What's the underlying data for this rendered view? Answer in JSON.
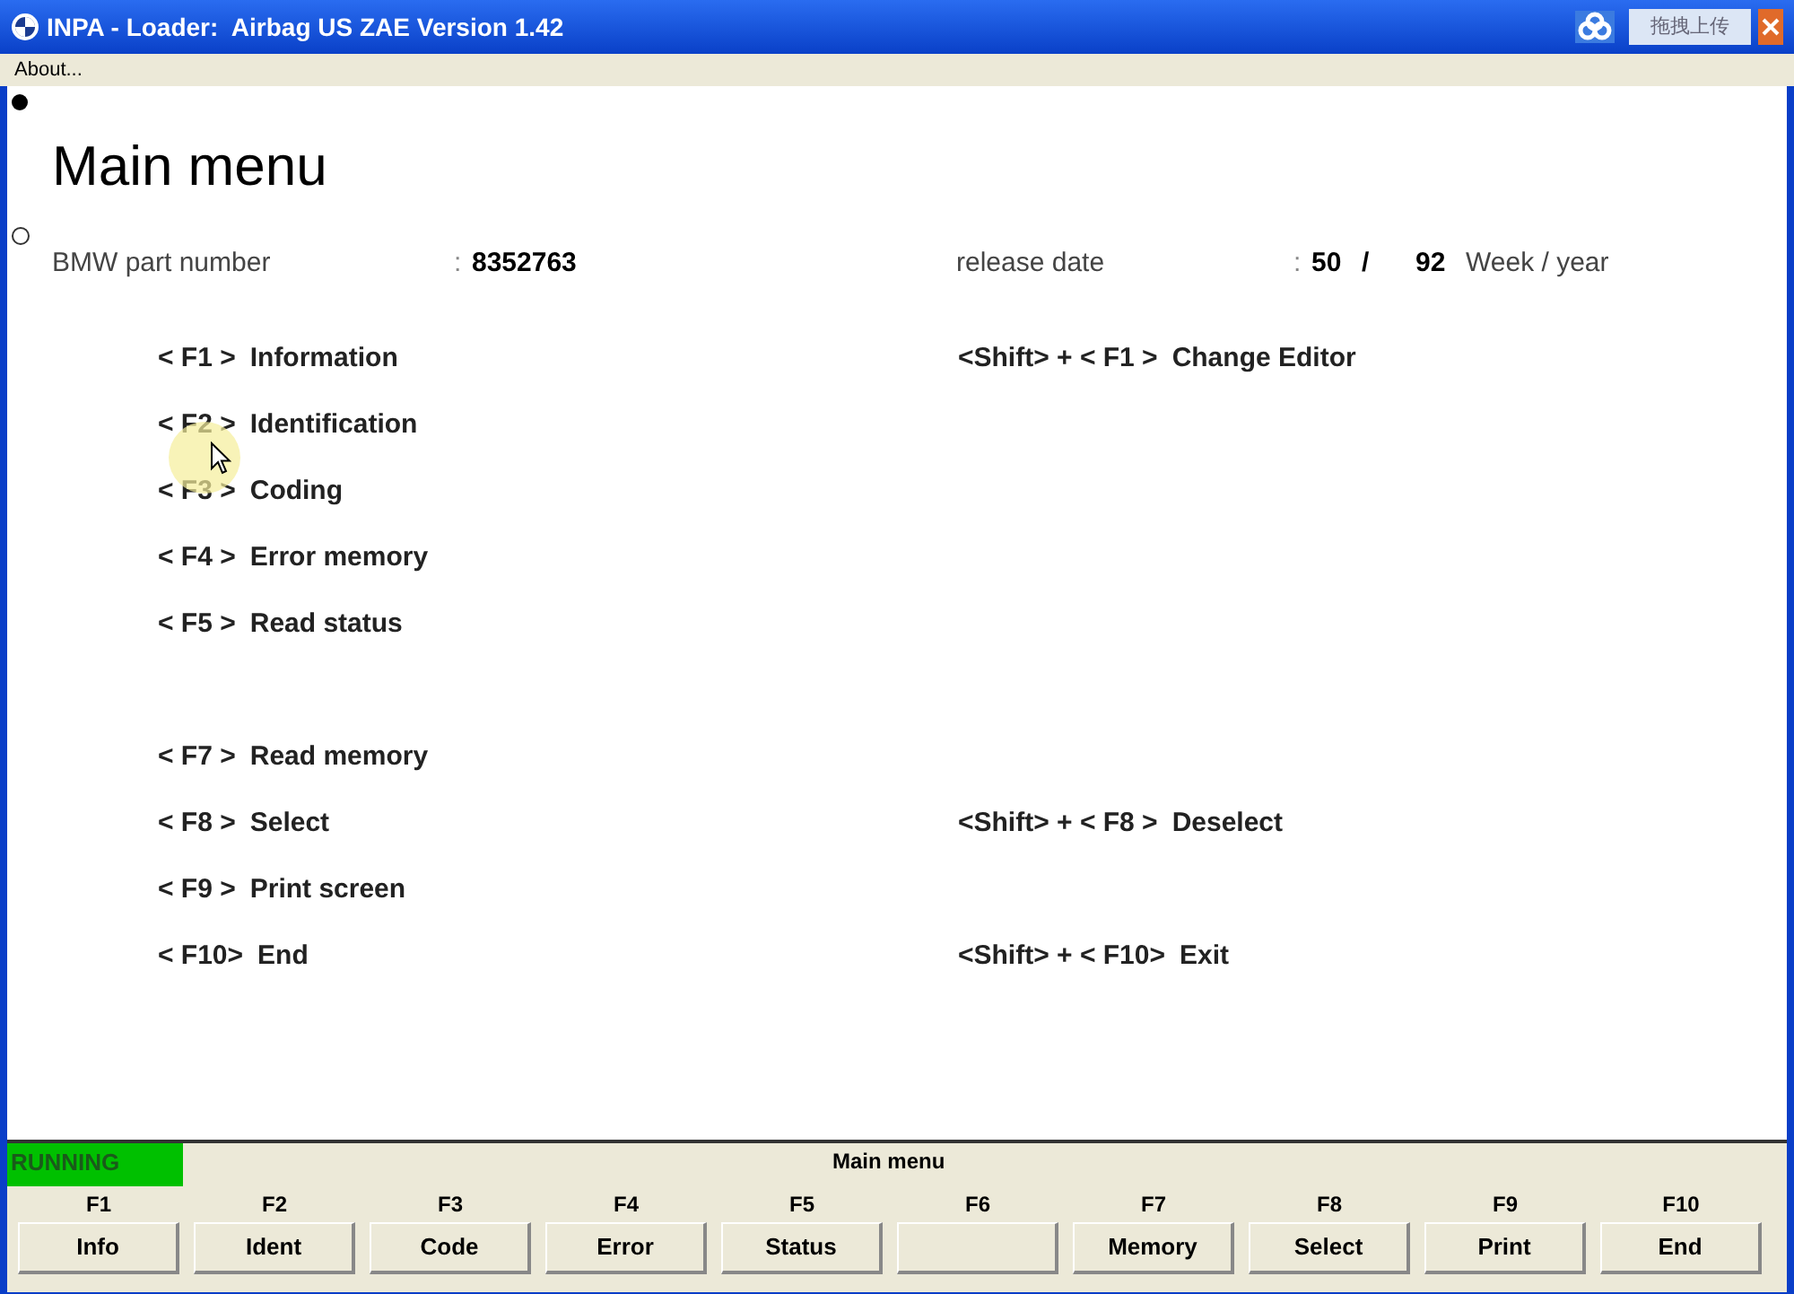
{
  "window": {
    "title": "INPA - Loader:  Airbag US ZAE Version 1.42",
    "upload_label": "拖拽上传"
  },
  "menu_bar": [
    "About..."
  ],
  "heading": "Main menu",
  "part_number": {
    "label": "BMW part number",
    "separator": ":",
    "value": "8352763"
  },
  "release_date": {
    "label": "release date",
    "separator": ":",
    "week": "50",
    "slash": "/",
    "year": "92",
    "unit": "Week / year"
  },
  "menu_rows": [
    {
      "kind": "entry",
      "left": {
        "key": "< F1 >",
        "label": "Information"
      },
      "right": {
        "key": "<Shift> + < F1 >",
        "label": "Change Editor"
      }
    },
    {
      "kind": "entry",
      "left": {
        "key": "< F2 >",
        "label": "Identification"
      }
    },
    {
      "kind": "entry",
      "left": {
        "key": "< F3 >",
        "label": "Coding"
      }
    },
    {
      "kind": "entry",
      "left": {
        "key": "< F4 >",
        "label": "Error memory"
      }
    },
    {
      "kind": "entry",
      "left": {
        "key": "< F5 >",
        "label": "Read status"
      }
    },
    {
      "kind": "gap"
    },
    {
      "kind": "entry",
      "left": {
        "key": "< F7 >",
        "label": "Read memory"
      }
    },
    {
      "kind": "entry",
      "left": {
        "key": "< F8 >",
        "label": "Select"
      },
      "right": {
        "key": "<Shift> + < F8 >",
        "label": "Deselect"
      }
    },
    {
      "kind": "entry",
      "left": {
        "key": "< F9 >",
        "label": "Print screen"
      }
    },
    {
      "kind": "entry",
      "left": {
        "key": "< F10>",
        "label": "End"
      },
      "right": {
        "key": "<Shift> + < F10>",
        "label": "Exit"
      }
    }
  ],
  "status": {
    "label": "RUNNING",
    "color": "#00c000",
    "screen": "Main menu"
  },
  "function_keys": [
    {
      "key": "F1",
      "label": "Info"
    },
    {
      "key": "F2",
      "label": "Ident"
    },
    {
      "key": "F3",
      "label": "Code"
    },
    {
      "key": "F4",
      "label": "Error"
    },
    {
      "key": "F5",
      "label": "Status"
    },
    {
      "key": "F6"
    },
    {
      "key": "F7",
      "label": "Memory"
    },
    {
      "key": "F8",
      "label": "Select"
    },
    {
      "key": "F9",
      "label": "Print"
    },
    {
      "key": "F10",
      "label": "End"
    }
  ]
}
